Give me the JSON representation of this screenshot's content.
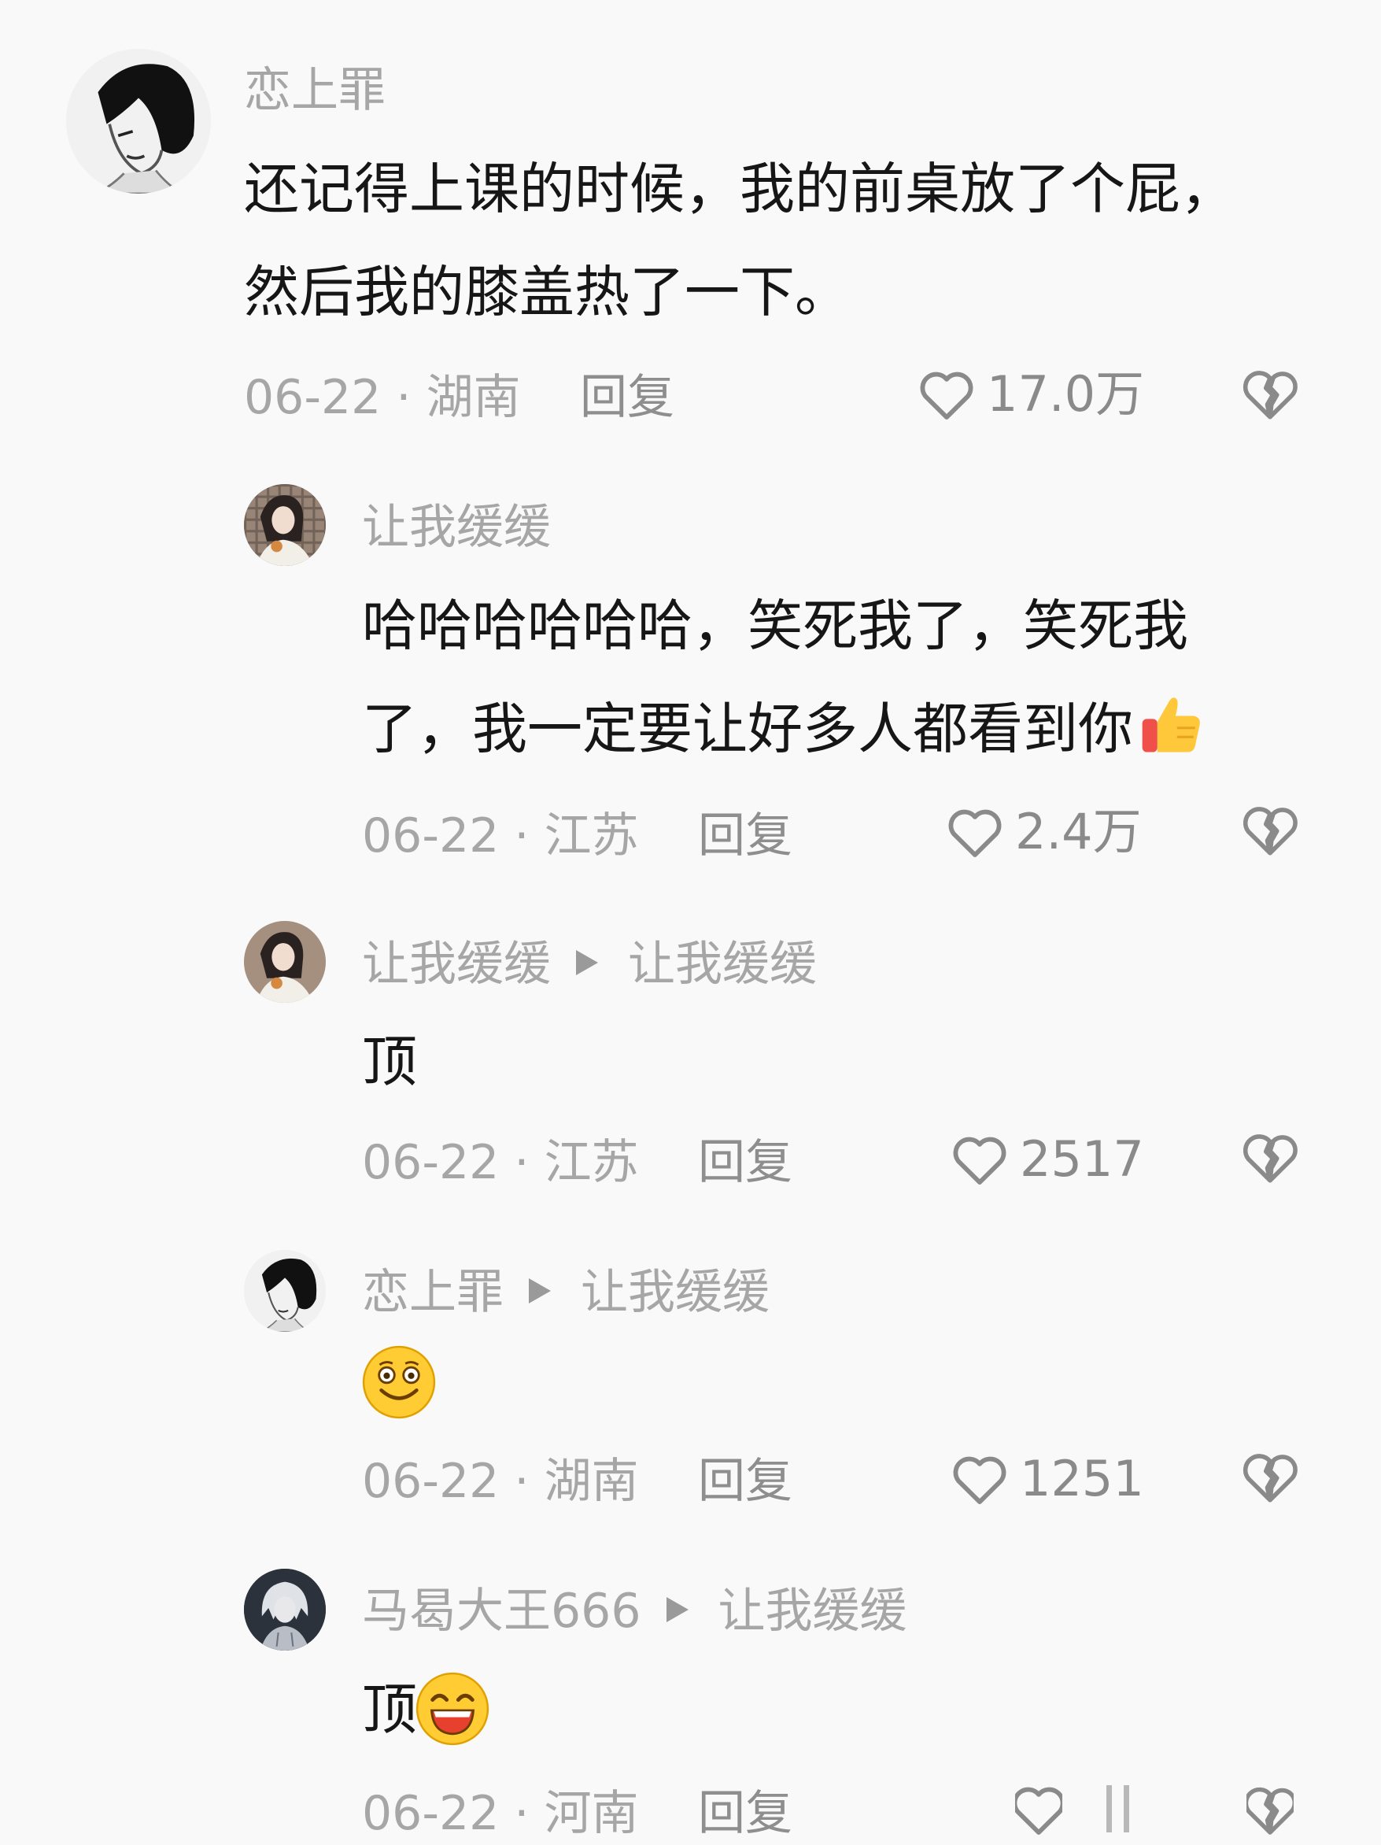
{
  "comments": [
    {
      "username": "恋上罪",
      "content_lines": [
        "还记得上课的时候，我的前桌放了个屁，",
        "然后我的膝盖热了一下。"
      ],
      "date_location": "06-22 · 湖南",
      "reply_label": "回复",
      "likes": "17.0万",
      "avatar_icon": "anime-boy-avatar-icon"
    },
    {
      "username": "让我缓缓",
      "content_lines": [
        "哈哈哈哈哈哈，笑死我了，笑死我",
        "了，我一定要让好多人都看到你"
      ],
      "content_emoji": "thumbs-up-emoji",
      "date_location": "06-22 · 江苏",
      "reply_label": "回复",
      "likes": "2.4万",
      "avatar_icon": "girl-photo-avatar-icon"
    },
    {
      "username": "让我缓缓",
      "reply_to": "让我缓缓",
      "content": "顶",
      "date_location": "06-22 · 江苏",
      "reply_label": "回复",
      "likes": "2517",
      "avatar_icon": "girl-photo-avatar-icon"
    },
    {
      "username": "恋上罪",
      "reply_to": "让我缓缓",
      "content_emoji": "smiling-face-emoji",
      "date_location": "06-22 · 湖南",
      "reply_label": "回复",
      "likes": "1251",
      "avatar_icon": "anime-boy-avatar-icon"
    },
    {
      "username": "马曷大王666",
      "reply_to": "让我缓缓",
      "content": "顶",
      "content_emoji": "grinning-face-emoji",
      "date_location": "06-22 · 河南",
      "reply_label": "回复",
      "avatar_icon": "silver-hair-avatar-icon"
    }
  ],
  "colors": {
    "background": "#f9f9f9",
    "username": "#a6a6a6",
    "content": "#161616",
    "meta": "#a6a6a6",
    "icon": "#8a8a8a"
  }
}
